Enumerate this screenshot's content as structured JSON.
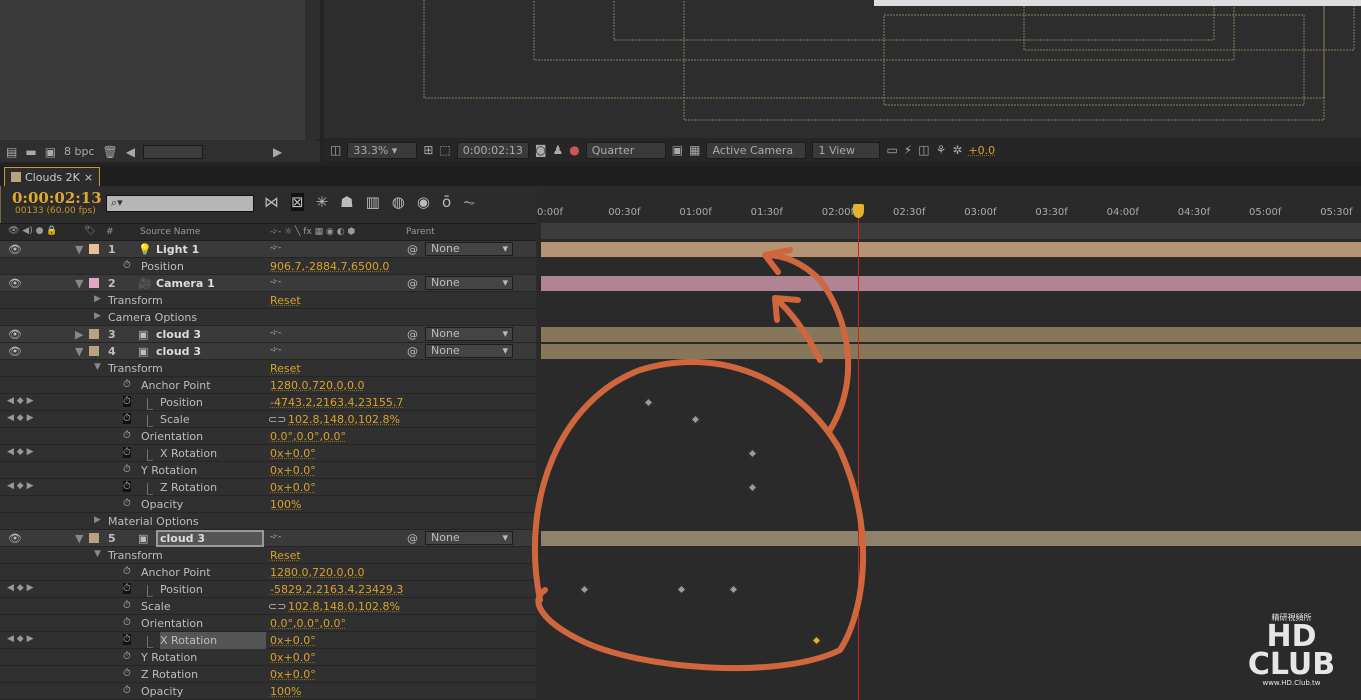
{
  "project": {
    "bpc": "8 bpc"
  },
  "viewer": {
    "zoom": "33.3%",
    "time": "0:00:02:13",
    "resolution": "Quarter",
    "camera": "Active Camera",
    "views": "1 View",
    "exposure": "+0.0"
  },
  "comp": {
    "tab": "Clouds 2K",
    "timecode": "0:00:02:13",
    "frames": "00133 (60.00 fps)",
    "search_placeholder": "⌕▾"
  },
  "columns": {
    "num": "#",
    "source": "Source Name",
    "parent": "Parent",
    "switches": "-፦- ☼ ╲ fx ▦ ◉ ◐ ⬢"
  },
  "rows": [
    {
      "type": "layer",
      "num": "1",
      "name": "Light 1",
      "icon": "light-icon",
      "color": "#e8bf9a",
      "parent": "None"
    },
    {
      "type": "prop",
      "name": "Position",
      "value": "906.7,-2884.7,6500.0",
      "indent": 2
    },
    {
      "type": "layer",
      "num": "2",
      "name": "Camera 1",
      "icon": "camera-icon",
      "color": "#e4a6c4",
      "parent": "None"
    },
    {
      "type": "group",
      "name": "Transform",
      "value": "Reset",
      "indent": 1,
      "twirl": "closed"
    },
    {
      "type": "group",
      "name": "Camera Options",
      "value": "",
      "indent": 1,
      "twirl": "closed"
    },
    {
      "type": "layer",
      "num": "3",
      "name": "cloud 3",
      "icon": "footage-icon",
      "color": "#b8a37e",
      "parent": "None",
      "closed": true
    },
    {
      "type": "layer",
      "num": "4",
      "name": "cloud 3",
      "icon": "footage-icon",
      "color": "#b8a37e",
      "parent": "None"
    },
    {
      "type": "group",
      "name": "Transform",
      "value": "Reset",
      "indent": 1,
      "twirl": "open"
    },
    {
      "type": "prop",
      "name": "Anchor Point",
      "value": "1280.0,720.0,0.0",
      "indent": 2
    },
    {
      "type": "prop",
      "name": "Position",
      "value": "-4743.2,2163.4,23155.7",
      "indent": 2,
      "animated": true
    },
    {
      "type": "prop",
      "name": "Scale",
      "value": "102.8,148.0,102.8%",
      "indent": 2,
      "animated": true,
      "link": true
    },
    {
      "type": "prop",
      "name": "Orientation",
      "value": "0.0°,0.0°,0.0°",
      "indent": 2
    },
    {
      "type": "prop",
      "name": "X Rotation",
      "value": "0x+0.0°",
      "indent": 2,
      "animated": true
    },
    {
      "type": "prop",
      "name": "Y Rotation",
      "value": "0x+0.0°",
      "indent": 2
    },
    {
      "type": "prop",
      "name": "Z Rotation",
      "value": "0x+0.0°",
      "indent": 2,
      "animated": true
    },
    {
      "type": "prop",
      "name": "Opacity",
      "value": "100%",
      "indent": 2
    },
    {
      "type": "group",
      "name": "Material Options",
      "value": "",
      "indent": 1,
      "twirl": "closed"
    },
    {
      "type": "layer",
      "num": "5",
      "name": "cloud 3",
      "icon": "footage-icon",
      "color": "#b8a37e",
      "parent": "None",
      "selected": true
    },
    {
      "type": "group",
      "name": "Transform",
      "value": "Reset",
      "indent": 1,
      "twirl": "open"
    },
    {
      "type": "prop",
      "name": "Anchor Point",
      "value": "1280.0,720.0,0.0",
      "indent": 2
    },
    {
      "type": "prop",
      "name": "Position",
      "value": "-5829.2,2163.4,23429.3",
      "indent": 2,
      "animated": true
    },
    {
      "type": "prop",
      "name": "Scale",
      "value": "102.8,148.0,102.8%",
      "indent": 2,
      "link": true
    },
    {
      "type": "prop",
      "name": "Orientation",
      "value": "0.0°,0.0°,0.0°",
      "indent": 2
    },
    {
      "type": "prop",
      "name": "X Rotation",
      "value": "0x+0.0°",
      "indent": 2,
      "animated": true,
      "highlight": true
    },
    {
      "type": "prop",
      "name": "Y Rotation",
      "value": "0x+0.0°",
      "indent": 2
    },
    {
      "type": "prop",
      "name": "Z Rotation",
      "value": "0x+0.0°",
      "indent": 2
    },
    {
      "type": "prop",
      "name": "Opacity",
      "value": "100%",
      "indent": 2
    }
  ],
  "timeline": {
    "fps": 60,
    "current_frame": 133,
    "ticks": [
      "0:00f",
      "00:30f",
      "01:00f",
      "01:30f",
      "02:00f",
      "02:30f",
      "03:00f",
      "03:30f",
      "04:00f",
      "04:30f",
      "05:00f",
      "05:30f"
    ],
    "bars": [
      {
        "row": 0,
        "color": "#b49473"
      },
      {
        "row": 2,
        "color": "#b08494"
      },
      {
        "row": 5,
        "color": "#86765a"
      },
      {
        "row": 6,
        "color": "#86765a"
      },
      {
        "row": 17,
        "color": "#8e826a"
      }
    ],
    "keyframes": [
      {
        "row": 9,
        "frame": 44
      },
      {
        "row": 10,
        "frame": 64
      },
      {
        "row": 12,
        "frame": 88
      },
      {
        "row": 14,
        "frame": 88
      },
      {
        "row": 20,
        "frame": 17
      },
      {
        "row": 20,
        "frame": 58
      },
      {
        "row": 20,
        "frame": 80
      },
      {
        "row": 23,
        "frame": 115,
        "selected": true
      }
    ]
  },
  "watermark": {
    "logo": "HD CLUB",
    "url": "www.HD.Club.tw",
    "top": "精研視頻所"
  }
}
